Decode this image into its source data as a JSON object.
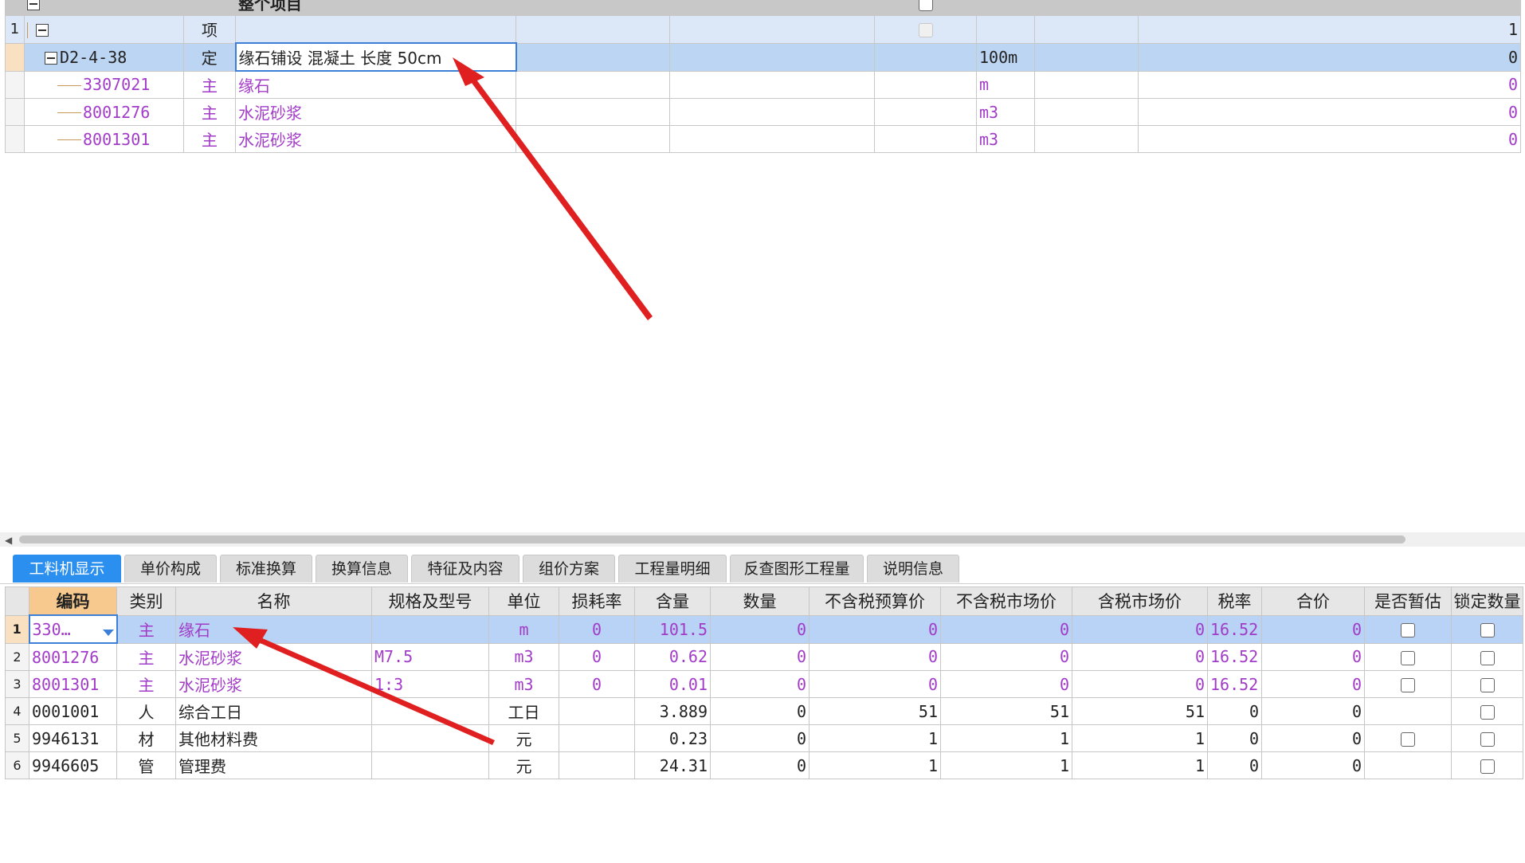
{
  "upper": {
    "header": {
      "title": "整个项目"
    },
    "rows": [
      {
        "num": "1",
        "code": "",
        "type": "项",
        "name": "",
        "unit": "",
        "qty": "1"
      },
      {
        "num": "",
        "code": "D2-4-38",
        "type": "定",
        "name": "缘石铺设 混凝土 长度 50cm",
        "unit": "100m",
        "qty": "0"
      },
      {
        "num": "",
        "code": "3307021",
        "type": "主",
        "name": "缘石",
        "unit": "m",
        "qty": "0"
      },
      {
        "num": "",
        "code": "8001276",
        "type": "主",
        "name": "水泥砂浆",
        "unit": "m3",
        "qty": "0"
      },
      {
        "num": "",
        "code": "8001301",
        "type": "主",
        "name": "水泥砂浆",
        "unit": "m3",
        "qty": "0"
      }
    ]
  },
  "tabs": [
    {
      "label": "工料机显示"
    },
    {
      "label": "单价构成"
    },
    {
      "label": "标准换算"
    },
    {
      "label": "换算信息"
    },
    {
      "label": "特征及内容"
    },
    {
      "label": "组价方案"
    },
    {
      "label": "工程量明细"
    },
    {
      "label": "反查图形工程量"
    },
    {
      "label": "说明信息"
    }
  ],
  "lower": {
    "headers": [
      "编码",
      "类别",
      "名称",
      "规格及型号",
      "单位",
      "损耗率",
      "含量",
      "数量",
      "不含税预算价",
      "不含税市场价",
      "含税市场价",
      "税率",
      "合价",
      "是否暂估",
      "锁定数量"
    ],
    "rows": [
      {
        "num": "1",
        "code": "330…",
        "type": "主",
        "name": "缘石",
        "spec": "",
        "unit": "m",
        "loss": "0",
        "content": "101.5",
        "qty": "0",
        "budget": "0",
        "market": "0",
        "taxmarket": "0",
        "rate": "16.52",
        "total": "0"
      },
      {
        "num": "2",
        "code": "8001276",
        "type": "主",
        "name": "水泥砂浆",
        "spec": "M7.5",
        "unit": "m3",
        "loss": "0",
        "content": "0.62",
        "qty": "0",
        "budget": "0",
        "market": "0",
        "taxmarket": "0",
        "rate": "16.52",
        "total": "0"
      },
      {
        "num": "3",
        "code": "8001301",
        "type": "主",
        "name": "水泥砂浆",
        "spec": "1:3",
        "unit": "m3",
        "loss": "0",
        "content": "0.01",
        "qty": "0",
        "budget": "0",
        "market": "0",
        "taxmarket": "0",
        "rate": "16.52",
        "total": "0"
      },
      {
        "num": "4",
        "code": "0001001",
        "type": "人",
        "name": "综合工日",
        "spec": "",
        "unit": "工日",
        "loss": "",
        "content": "3.889",
        "qty": "0",
        "budget": "51",
        "market": "51",
        "taxmarket": "51",
        "rate": "0",
        "total": "0"
      },
      {
        "num": "5",
        "code": "9946131",
        "type": "材",
        "name": "其他材料费",
        "spec": "",
        "unit": "元",
        "loss": "",
        "content": "0.23",
        "qty": "0",
        "budget": "1",
        "market": "1",
        "taxmarket": "1",
        "rate": "0",
        "total": "0"
      },
      {
        "num": "6",
        "code": "9946605",
        "type": "管",
        "name": "管理费",
        "spec": "",
        "unit": "元",
        "loss": "",
        "content": "24.31",
        "qty": "0",
        "budget": "1",
        "market": "1",
        "taxmarket": "1",
        "rate": "0",
        "total": "0"
      }
    ]
  },
  "colors": {
    "accent": "#2b8ff0",
    "selection": "#b8d3f5",
    "material_text": "#a23cc8",
    "annotation_arrow": "#e02020"
  }
}
